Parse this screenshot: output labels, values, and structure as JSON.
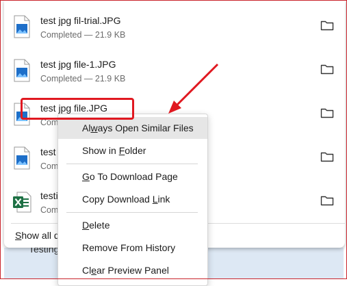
{
  "downloads": [
    {
      "name": "test jpg fil-trial.JPG",
      "status": "Completed — 21.9 KB",
      "type": "image"
    },
    {
      "name": "test jpg file-1.JPG",
      "status": "Completed — 21.9 KB",
      "type": "image"
    },
    {
      "name": "test jpg file.JPG",
      "status": "Com",
      "type": "image"
    },
    {
      "name": "test",
      "status": "Com",
      "type": "image"
    },
    {
      "name": "testi",
      "status": "Com",
      "type": "excel"
    }
  ],
  "panel": {
    "show_all": "Show all d",
    "behind_text": "Testing"
  },
  "context_menu": {
    "items": [
      {
        "pre": "Al",
        "acc": "w",
        "post": "ays Open Similar Files"
      },
      {
        "pre": "Show in ",
        "acc": "F",
        "post": "older"
      },
      {
        "pre": "",
        "acc": "G",
        "post": "o To Download Page"
      },
      {
        "pre": "Copy Download ",
        "acc": "L",
        "post": "ink"
      },
      {
        "pre": "",
        "acc": "D",
        "post": "elete"
      },
      {
        "pre": "Remove From History",
        "acc": "",
        "post": ""
      },
      {
        "pre": "Cl",
        "acc": "e",
        "post": "ar Preview Panel"
      }
    ]
  },
  "icons": {
    "file": "image-file-icon",
    "excel": "excel-file-icon",
    "folder": "folder-icon"
  },
  "colors": {
    "highlight": "#e01820",
    "menu_hover": "#e6e6e6",
    "excel_green": "#1d7044",
    "image_blue": "#1e6fc9"
  }
}
